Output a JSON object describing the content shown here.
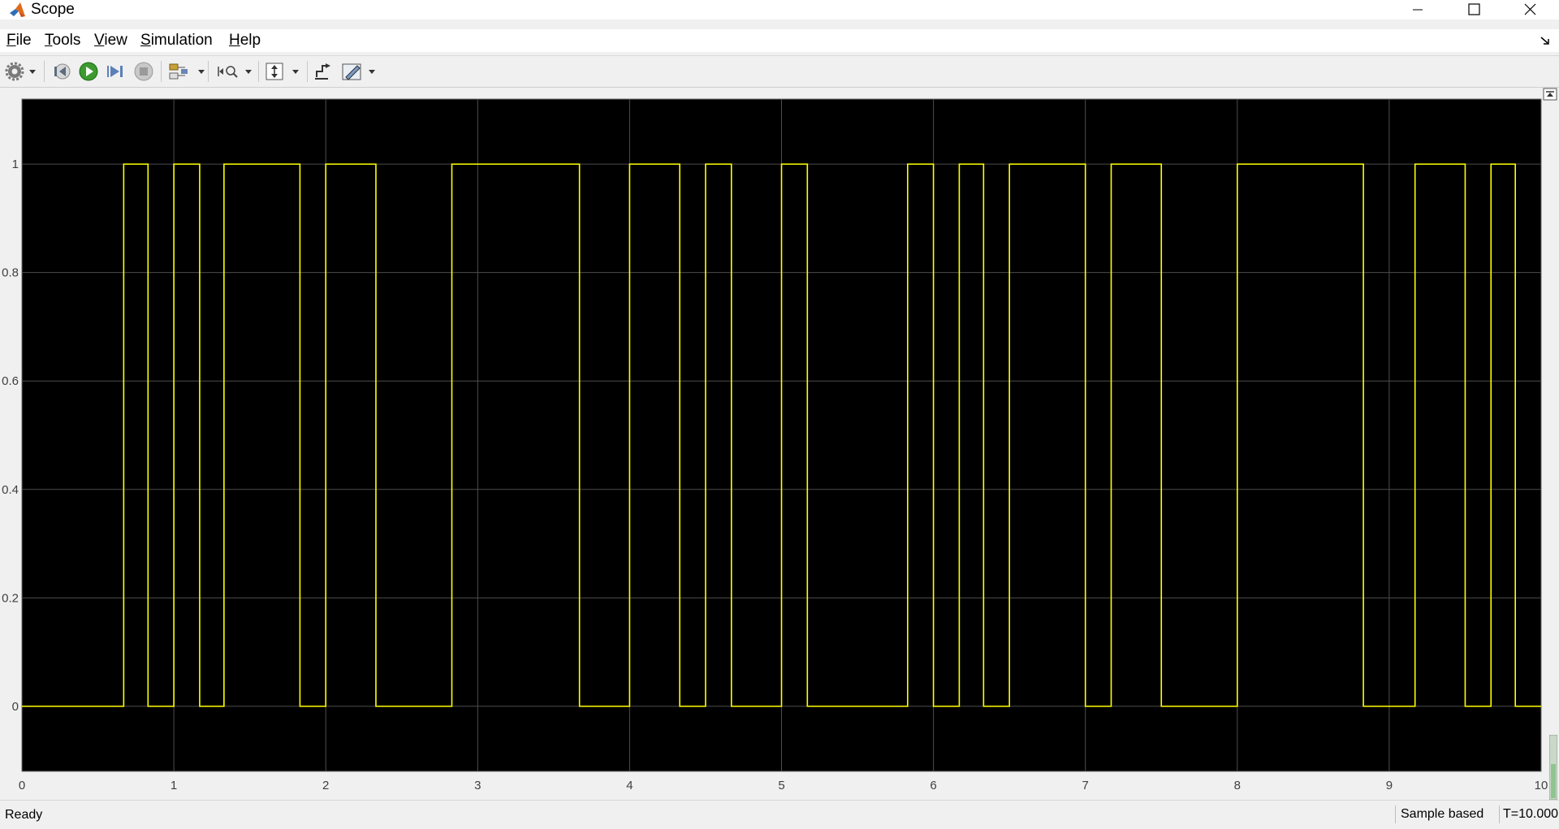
{
  "window": {
    "title": "Scope",
    "minimize_icon": "minimize-icon",
    "maximize_icon": "maximize-icon",
    "close_icon": "close-icon"
  },
  "menu": {
    "items": [
      {
        "label_acc": "F",
        "label_rest": "ile"
      },
      {
        "label_acc": "T",
        "label_rest": "ools"
      },
      {
        "label_acc": "V",
        "label_rest": "iew"
      },
      {
        "label_acc": "S",
        "label_rest": "imulation"
      },
      {
        "label_acc": "H",
        "label_rest": "elp"
      }
    ]
  },
  "toolbar": {
    "icons": [
      "gear-icon",
      "step-back-icon",
      "run-icon",
      "step-forward-icon",
      "stop-icon",
      "signal-select-icon",
      "zoom-icon",
      "autoscale-icon",
      "highlight-icon",
      "measurements-icon"
    ]
  },
  "status": {
    "text": "Ready",
    "mode": "Sample based",
    "time": "T=10.000"
  },
  "colors": {
    "plot_background": "#000000",
    "trace": "#ffff00",
    "grid": "#4d4d4d",
    "axis_text": "#cccccc"
  },
  "chart_data": {
    "type": "line",
    "step": true,
    "xlim": [
      0,
      10
    ],
    "ylim": [
      -0.12,
      1.12
    ],
    "xticks": [
      "0",
      "1",
      "2",
      "3",
      "4",
      "5",
      "6",
      "7",
      "8",
      "9",
      "10"
    ],
    "yticks": [
      "0",
      "0.2",
      "0.4",
      "0.6",
      "0.8",
      "1"
    ],
    "ytick_values": [
      0,
      0.2,
      0.4,
      0.6,
      0.8,
      1
    ],
    "grid": true,
    "series": [
      {
        "x": [
          0,
          0.67,
          0.83,
          1.0,
          1.17,
          1.33,
          1.83,
          2.0,
          2.33,
          2.83,
          3.67,
          4.0,
          4.33,
          4.5,
          4.67,
          5.0,
          5.17,
          5.83,
          6.0,
          6.17,
          6.33,
          6.5,
          7.0,
          7.17,
          7.5,
          8.0,
          8.83,
          9.17,
          9.5,
          9.67,
          9.83,
          10.0
        ],
        "y": [
          0,
          1,
          0,
          1,
          0,
          1,
          0,
          1,
          0,
          1,
          0,
          1,
          0,
          1,
          0,
          1,
          0,
          1,
          0,
          1,
          0,
          1,
          0,
          1,
          0,
          1,
          0,
          1,
          0,
          1,
          0,
          0
        ]
      }
    ]
  }
}
